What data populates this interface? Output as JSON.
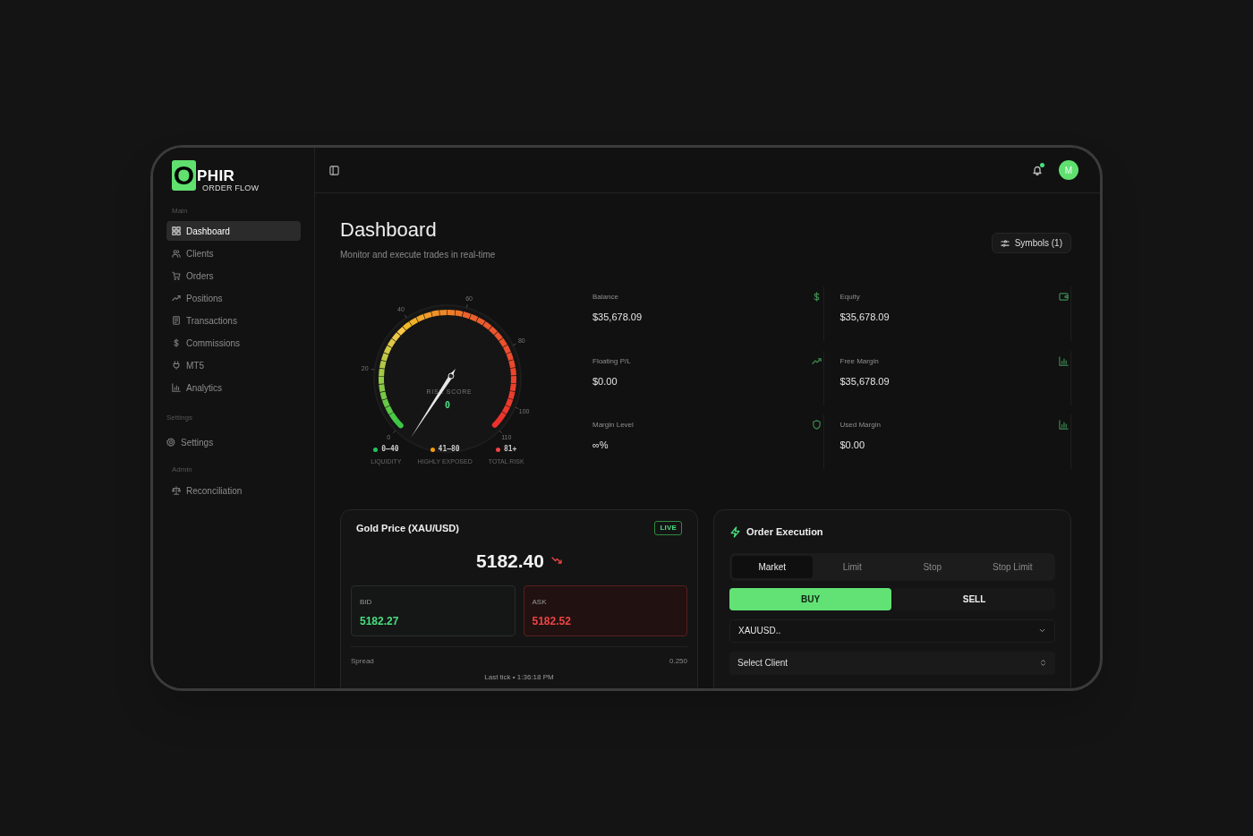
{
  "sidebar": {
    "logo": {
      "mark": "O",
      "name": "PHIR",
      "tagline": "ORDER FLOW"
    },
    "sections": [
      {
        "title": "Main",
        "items": [
          {
            "label": "Dashboard",
            "selected": true
          },
          {
            "label": "Clients",
            "selected": false
          },
          {
            "label": "Orders",
            "selected": false
          },
          {
            "label": "Positions",
            "selected": false
          },
          {
            "label": "Transactions",
            "selected": false
          },
          {
            "label": "Commissions",
            "selected": false
          },
          {
            "label": "MT5",
            "selected": false
          },
          {
            "label": "Analytics",
            "selected": false
          }
        ]
      },
      {
        "title": "Settings",
        "items": [
          {
            "label": "Settings",
            "selected": false
          }
        ]
      },
      {
        "title": "Admin",
        "items": [
          {
            "label": "Reconciliation",
            "selected": false
          }
        ]
      }
    ]
  },
  "header": {
    "avatar": "M",
    "notification": true
  },
  "page": {
    "title": "Dashboard",
    "subtitle": "Monitor and execute trades in real-time",
    "symbols_button": "Symbols (1)"
  },
  "risk_gauge": {
    "ticks": [
      "0",
      "20",
      "40",
      "60",
      "80",
      "100",
      "110"
    ],
    "label": "RISK SCORE",
    "score": "0",
    "legend": [
      {
        "range": "0–40",
        "label": "LIQUIDITY",
        "color": "#22c55e"
      },
      {
        "range": "41–80",
        "label": "HIGHLY EXPOSED",
        "color": "#f59e0b"
      },
      {
        "range": "81+",
        "label": "TOTAL RISK",
        "color": "#ef4444"
      }
    ]
  },
  "stats": [
    {
      "label": "Balance",
      "value": "$35,678.09"
    },
    {
      "label": "Equity",
      "value": "$35,678.09"
    },
    {
      "label": "Floating P/L",
      "value": "$0.00"
    },
    {
      "label": "Free Margin",
      "value": "$35,678.09"
    },
    {
      "label": "Margin Level",
      "value": "∞%"
    },
    {
      "label": "Used Margin",
      "value": "$0.00"
    }
  ],
  "gold_price": {
    "title": "Gold Price (XAU/USD)",
    "badge": "LIVE",
    "price": "5182.40",
    "falling": true,
    "bid": {
      "label": "BID",
      "value": "5182.27"
    },
    "ask": {
      "label": "ASK",
      "value": "5182.52"
    },
    "spread_label": "Spread",
    "spread": "0.250",
    "last_tick": "Last tick • 1:36:18 PM"
  },
  "order_execution": {
    "title": "Order Execution",
    "order_types": [
      {
        "label": "Market",
        "selected": true
      },
      {
        "label": "Limit",
        "selected": false
      },
      {
        "label": "Stop",
        "selected": false
      },
      {
        "label": "Stop Limit",
        "selected": false
      }
    ],
    "sides": [
      {
        "label": "BUY",
        "selected": true
      },
      {
        "label": "SELL",
        "selected": false
      }
    ],
    "symbol": "XAUUSD..",
    "client_placeholder": "Select Client"
  }
}
